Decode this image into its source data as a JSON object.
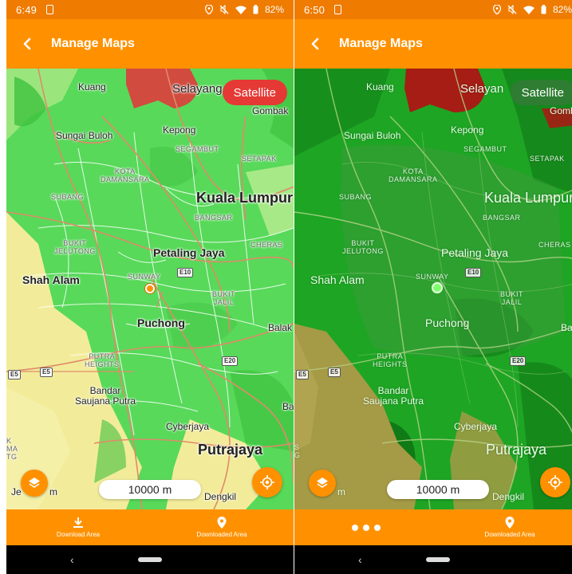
{
  "screens": [
    {
      "status": {
        "time": "6:49",
        "battery": "82%"
      },
      "app_bar": {
        "title": "Manage Maps"
      },
      "map": {
        "mode": "standard",
        "satellite_label": "Satellite",
        "scale": "10000 m",
        "places": {
          "kuang": "Kuang",
          "selayang": "Selayang",
          "gombak": "Gombak",
          "sungai_buloh": "Sungai Buloh",
          "kepong": "Kepong",
          "segambut": "SEGAMBUT",
          "setapak": "SETAPAK",
          "kota_damansara": "KOTA\nDAMANSARA",
          "subang": "SUBANG",
          "kuala_lumpur": "Kuala Lumpur",
          "bangsar": "BANGSAR",
          "bukit_jelutong": "BUKIT\nJELUTONG",
          "cheras": "CHERAS",
          "petaling_jaya": "Petaling Jaya",
          "shah_alam": "Shah Alam",
          "sunway": "SUNWAY",
          "bukit_jalil": "BUKIT\nJALIL",
          "puchong": "Puchong",
          "balak": "Balak",
          "putra_heights": "PUTRA\nHEIGHTS",
          "bandar_saujana_putra": "Bandar\nSaujana Putra",
          "cyberjaya": "Cyberjaya",
          "putrajaya": "Putrajaya",
          "dengkil": "Dengkil",
          "semenyih_edge": "Ba",
          "jenjarom_edge": "Je",
          "jenjarom_m": "m",
          "left_edge": "K\nMA\nTG"
        },
        "shields": {
          "e10": "E10",
          "e20": "E20",
          "e5a": "E5",
          "e5b": "E5"
        }
      },
      "bottom_nav": {
        "download_label": "Download Area",
        "downloaded_label": "Downloaded Area"
      }
    },
    {
      "status": {
        "time": "6:50",
        "battery": "82%"
      },
      "app_bar": {
        "title": "Manage Maps"
      },
      "map": {
        "mode": "satellite",
        "satellite_label": "Satellite",
        "scale": "10000 m",
        "places": {
          "kuang": "Kuang",
          "selayang": "Selayan",
          "gombak": "Gombak",
          "sungai_buloh": "Sungai Buloh",
          "kepong": "Kepong",
          "segambut": "SEGAMBUT",
          "setapak": "SETAPAK",
          "kota_damansara": "KOTA\nDAMANSARA",
          "subang": "SUBANG",
          "kuala_lumpur": "Kuala Lumpur",
          "bangsar": "BANGSAR",
          "bukit_jelutong": "BUKIT\nJELUTONG",
          "cheras": "CHERAS",
          "petaling_jaya": "Petaling Jaya",
          "shah_alam": "Shah Alam",
          "sunway": "SUNWAY",
          "bukit_jalil": "BUKIT\nJALIL",
          "puchong": "Puchong",
          "balak": "Bal",
          "putra_heights": "PUTRA\nHEIGHTS",
          "bandar_saujana_putra": "Bandar\nSaujana Putra",
          "cyberjaya": "Cyberjaya",
          "putrajaya": "Putrajaya",
          "dengkil": "Dengkil",
          "semenyih_edge": "",
          "jenjarom_edge": "",
          "jenjarom_m": "m",
          "left_edge": "S\nG"
        },
        "shields": {
          "e10": "E10",
          "e20": "E20",
          "e5a": "E5",
          "e5b": "E5"
        }
      },
      "bottom_nav": {
        "download_label": "",
        "downloaded_label": "Downloaded Area"
      }
    }
  ],
  "colors": {
    "status_bar": "#ef7b00",
    "app_bar": "#ff9100",
    "satellite_btn_standard": "#e53935",
    "satellite_btn_satellite": "#2e7d32",
    "map_green": "#58d95a",
    "map_yellow": "#f2ec9a",
    "map_red": "#d14b3f",
    "sat_green": "#1ea524",
    "sat_red": "#a51d14",
    "sat_olive": "#a59a45"
  },
  "icons": {
    "back": "chevron-left-icon",
    "layers": "layers-icon",
    "locate": "crosshair-icon",
    "download": "download-icon",
    "downloaded": "map-pin-icon",
    "more": "more-dots-icon"
  }
}
